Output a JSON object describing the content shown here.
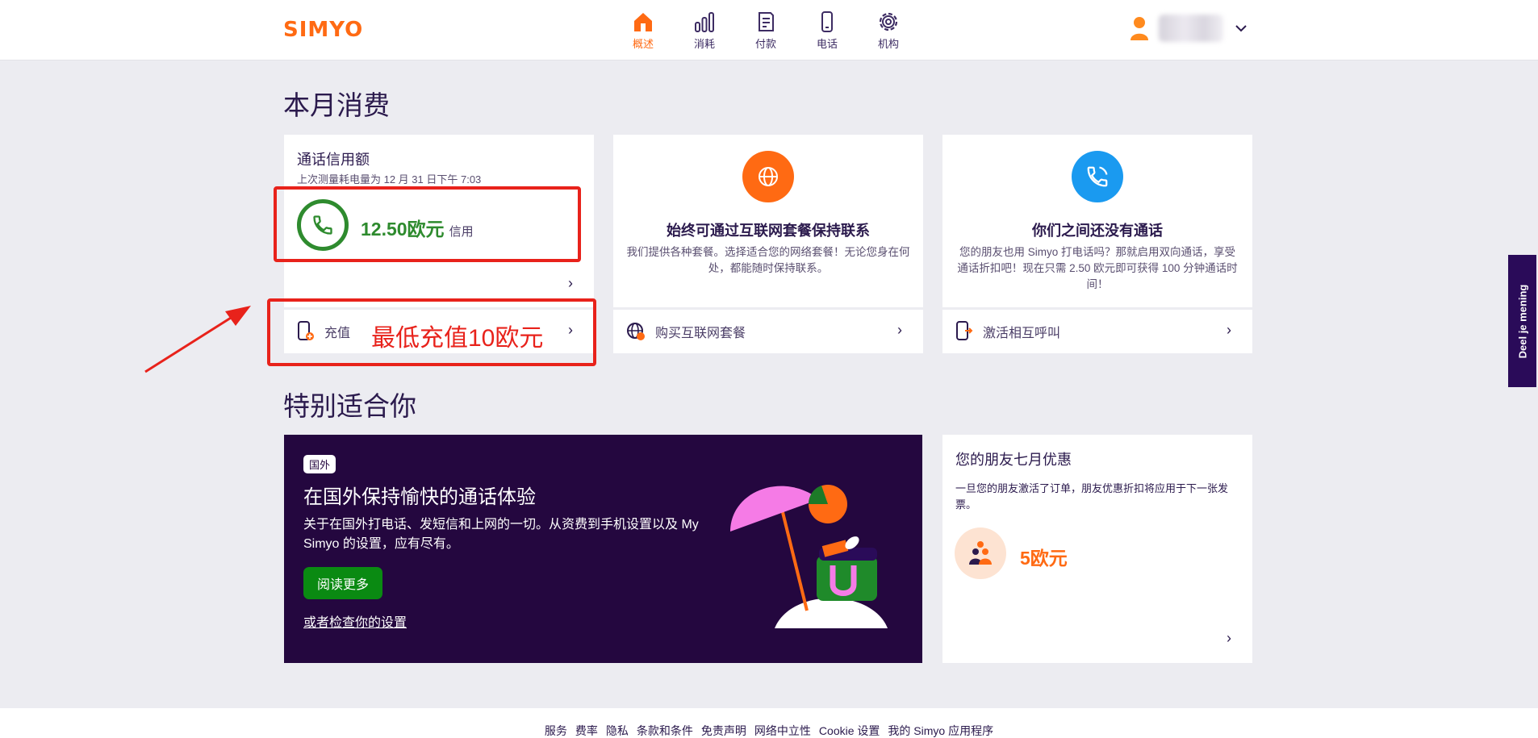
{
  "header": {
    "logo": "SIMYO",
    "nav": [
      {
        "label": "概述",
        "icon": "home-icon",
        "active": true
      },
      {
        "label": "消耗",
        "icon": "bar-chart-icon",
        "active": false
      },
      {
        "label": "付款",
        "icon": "invoice-icon",
        "active": false
      },
      {
        "label": "电话",
        "icon": "phone-device-icon",
        "active": false
      },
      {
        "label": "机构",
        "icon": "gear-icon",
        "active": false
      }
    ]
  },
  "section1": {
    "title": "本月消费"
  },
  "credit_card": {
    "title": "通话信用额",
    "subtitle": "上次测量耗电量为 12 月 31 日下午 7:03",
    "amount": "12.50欧元",
    "amount_suffix": "信用",
    "topup_label": "充值",
    "annotation": "最低充值10欧元"
  },
  "internet_card": {
    "title": "始终可通过互联网套餐保持联系",
    "text": "我们提供各种套餐。选择适合您的网络套餐！无论您身在何处，都能随时保持联系。",
    "action": "购买互联网套餐"
  },
  "calls_card": {
    "title": "你们之间还没有通话",
    "text": "您的朋友也用 Simyo 打电话吗？那就启用双向通话，享受通话折扣吧！现在只需 2.50 欧元即可获得 100 分钟通话时间！",
    "action": "激活相互呼叫"
  },
  "section2": {
    "title": "特别适合你"
  },
  "promo": {
    "badge": "国外",
    "title": "在国外保持愉快的通话体验",
    "text": "关于在国外打电话、发短信和上网的一切。从资费到手机设置以及 My Simyo 的设置，应有尽有。",
    "button": "阅读更多",
    "link": "或者检查你的设置"
  },
  "friend_card": {
    "title": "您的朋友七月优惠",
    "text": "一旦您的朋友激活了订单，朋友优惠折扣将应用于下一张发票。",
    "amount": "5欧元"
  },
  "footer": {
    "links": [
      "服务",
      "费率",
      "隐私",
      "条款和条件",
      "免责声明",
      "网络中立性",
      "Cookie 设置",
      "我的 Simyo 应用程序"
    ]
  },
  "feedback": {
    "label": "Deel je mening"
  },
  "colors": {
    "brand_orange": "#ff6a13",
    "brand_purple": "#2b1a4d",
    "credit_green": "#2e8b2e",
    "annotation_red": "#e8221b",
    "call_blue": "#1a9af0"
  }
}
